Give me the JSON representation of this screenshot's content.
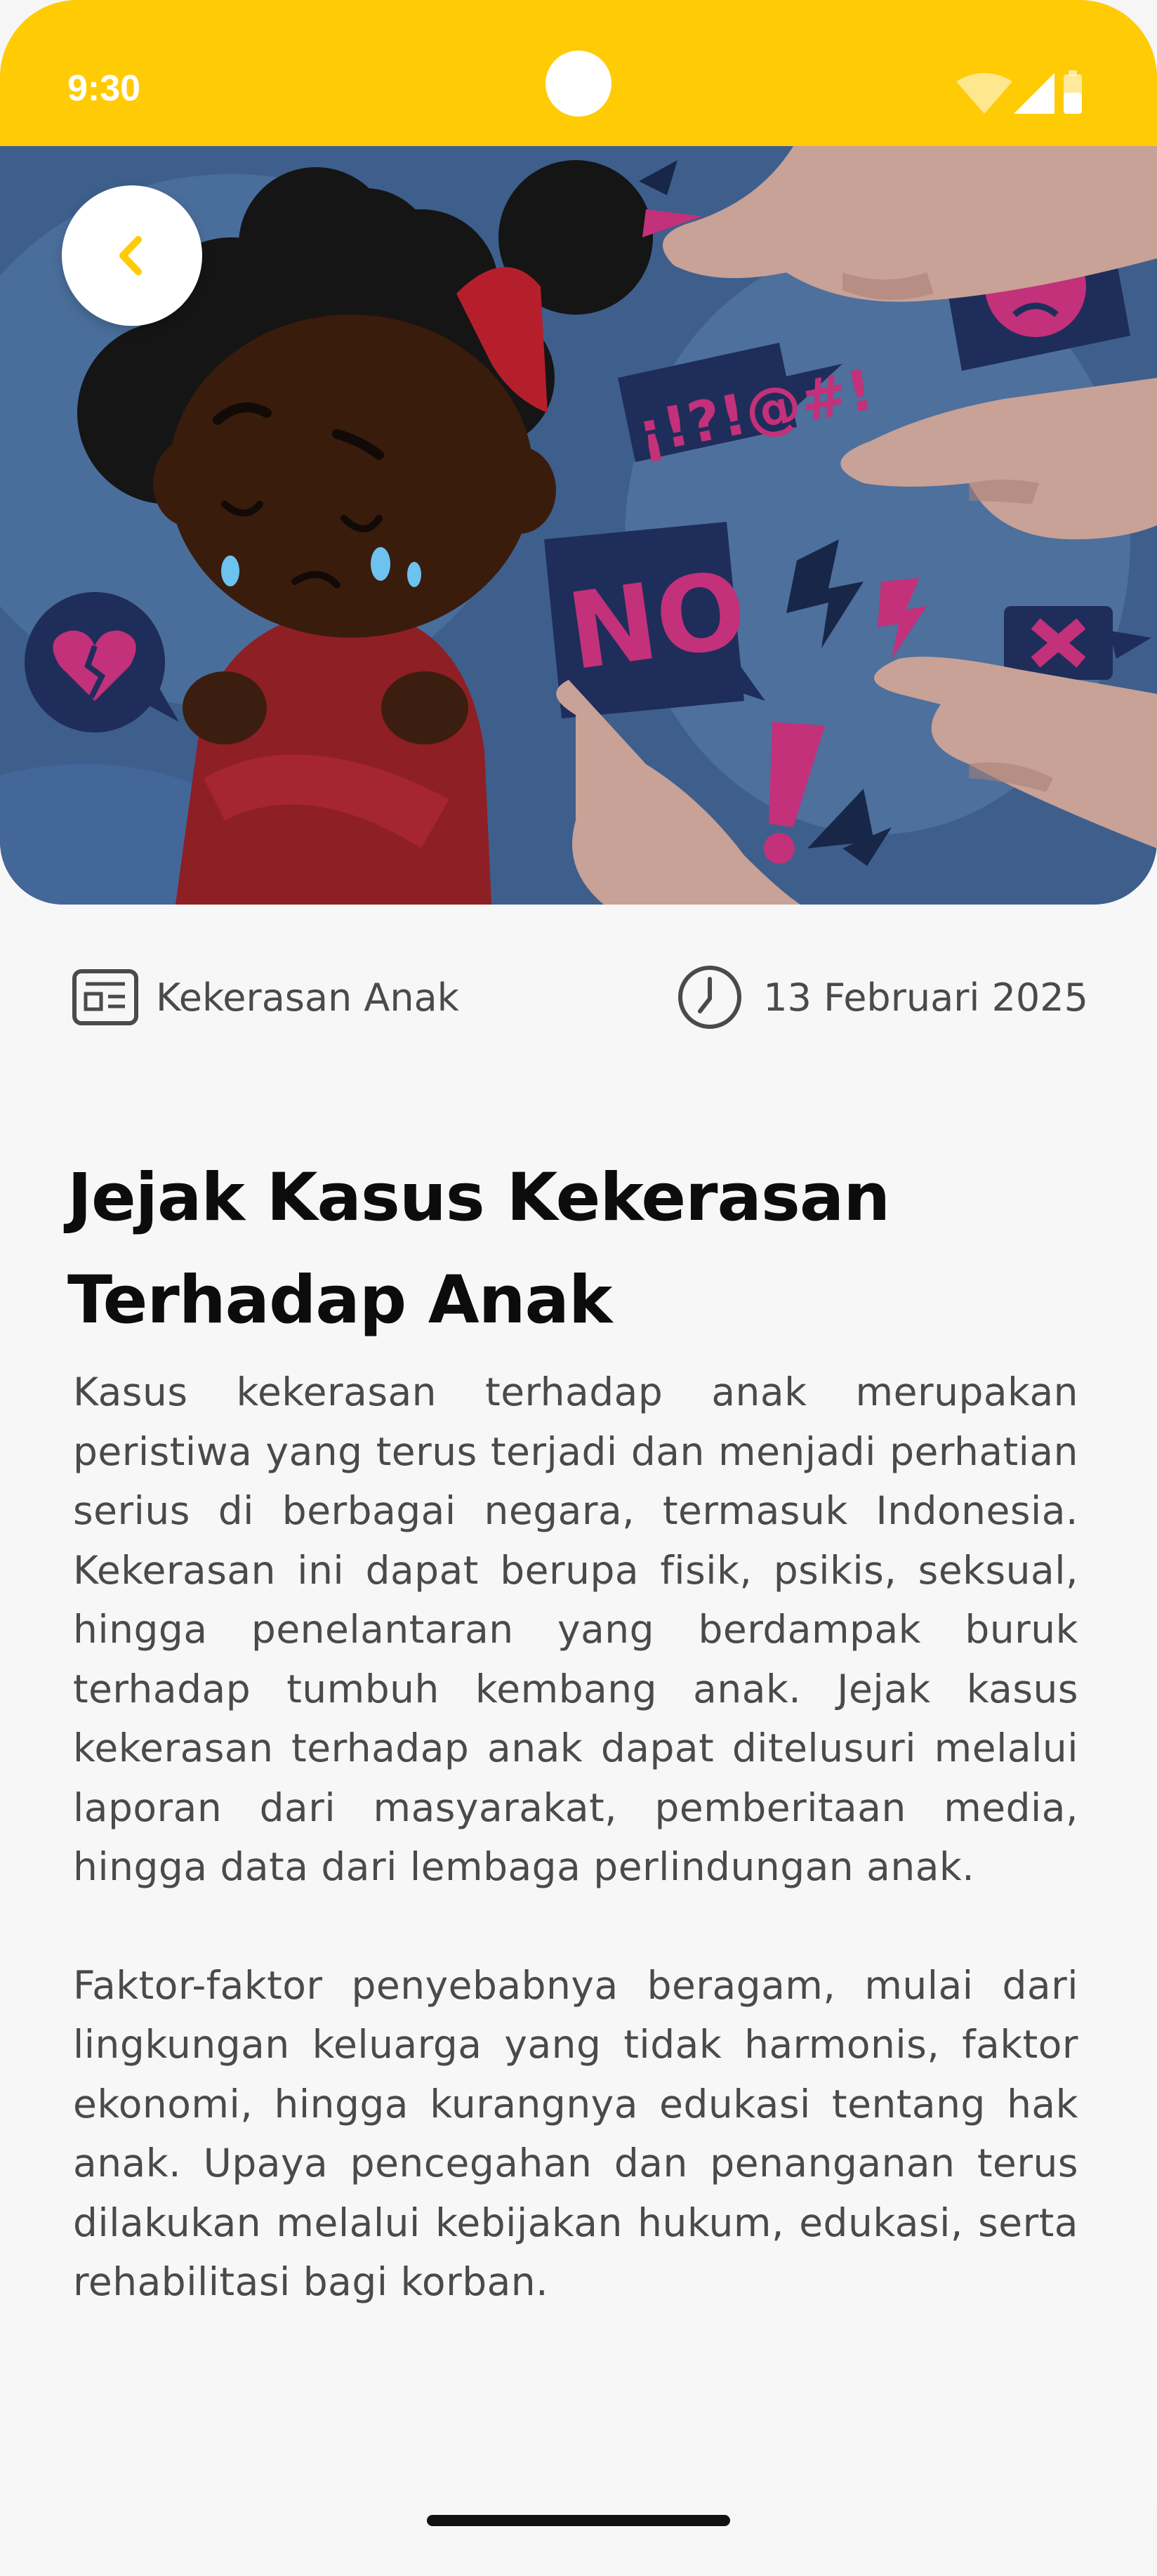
{
  "status_bar": {
    "time": "9:30",
    "background": "#FFCB05",
    "icons": [
      "wifi-icon",
      "cellular-signal-icon",
      "battery-icon"
    ]
  },
  "hero": {
    "image": "child-bullying-illustration",
    "speech_bubble_text_1": "¡!?!@#!",
    "speech_bubble_text_2": "NO"
  },
  "header": {
    "back_icon": "chevron-left-icon",
    "accent": "#FFCB05"
  },
  "article": {
    "category": "Kekerasan Anak",
    "category_icon": "newspaper-icon",
    "date": "13 Februari 2025",
    "date_icon": "clock-icon",
    "title": "Jejak Kasus Kekerasan Terhadap Anak",
    "paragraphs": [
      "Kasus kekerasan terhadap anak merupakan peristiwa yang terus terjadi dan menjadi perhatian serius di berbagai negara, termasuk Indonesia. Kekerasan ini dapat berupa fisik, psikis, seksual, hingga penelantaran yang berdampak buruk terhadap tumbuh kembang anak. Jejak kasus kekerasan terhadap anak dapat ditelusuri melalui laporan dari masyarakat, pemberitaan media, hingga data dari lembaga perlindungan anak.",
      "Faktor-faktor penyebabnya beragam, mulai dari lingkungan keluarga yang tidak harmonis, faktor ekonomi, hingga kurangnya edukasi tentang hak anak. Upaya pencegahan dan penanganan terus dilakukan melalui kebijakan hukum, edukasi, serta rehabilitasi bagi korban."
    ]
  }
}
